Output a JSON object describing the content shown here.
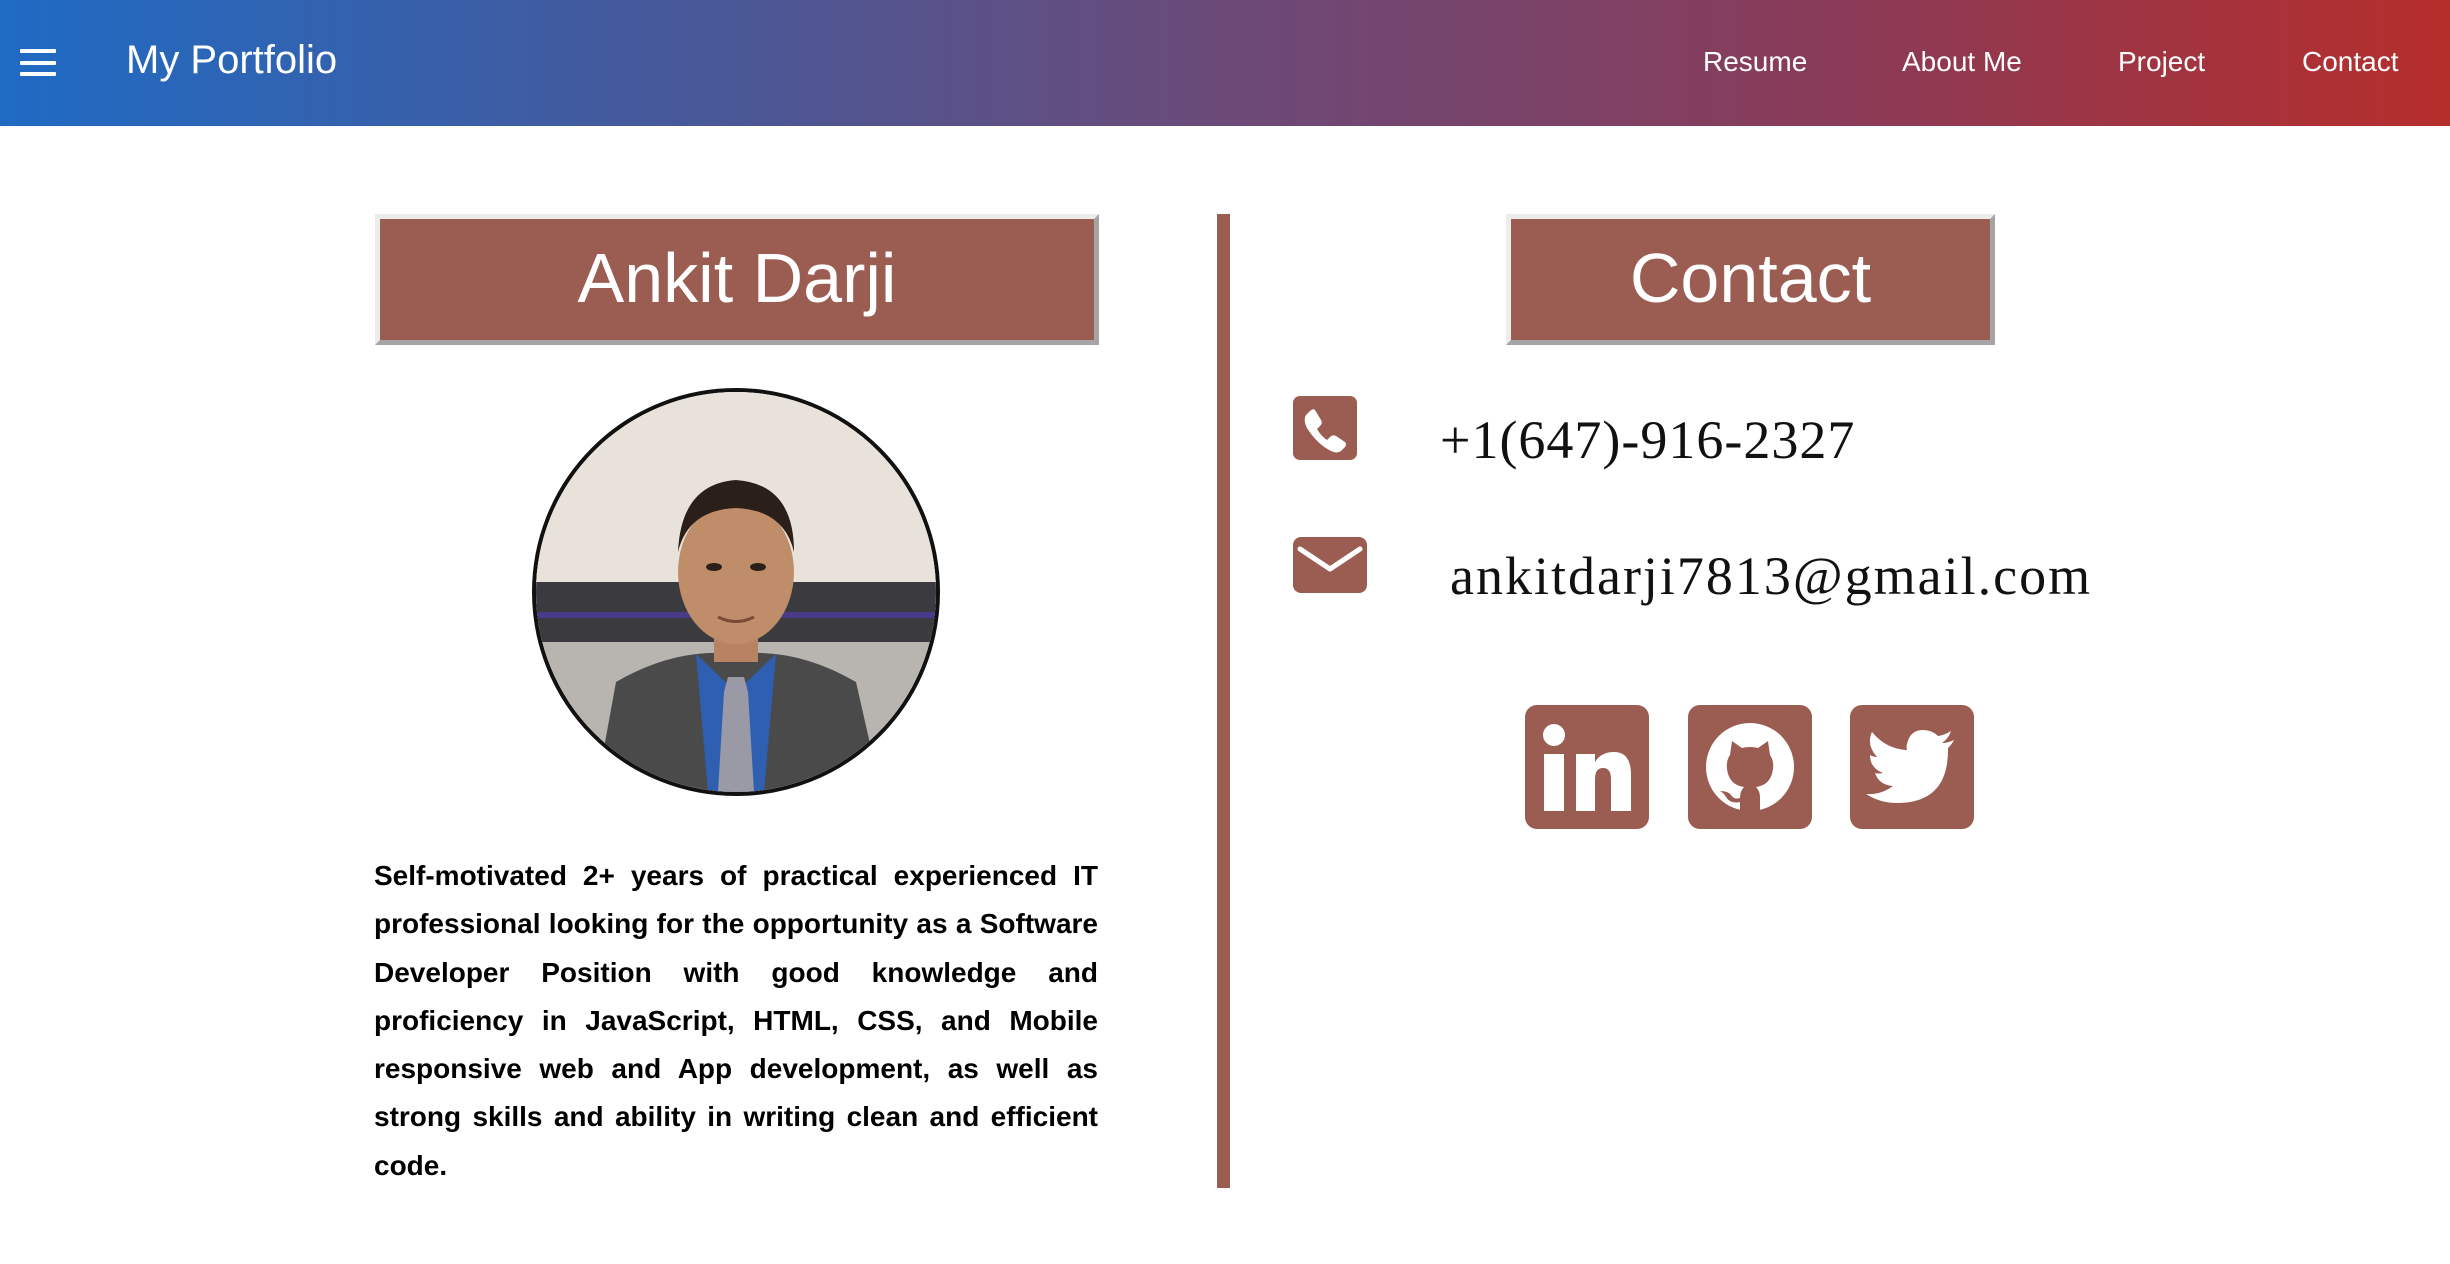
{
  "header": {
    "brand": "My Portfolio",
    "nav": [
      "Resume",
      "About Me",
      "Project",
      "Contact"
    ],
    "menu_icon": "hamburger-menu-icon"
  },
  "profile": {
    "name": "Ankit Darji",
    "bio": "Self-motivated 2+ years of practical experienced IT professional looking for the opportunity as a Software Developer Position with good knowledge and proficiency in JavaScript, HTML, CSS, and Mobile responsive web and App development, as well as strong skills and ability in writing clean and efficient code."
  },
  "contact": {
    "title": "Contact",
    "phone": "+1(647)-916-2327",
    "email": "ankitdarji7813@gmail.com",
    "phone_icon": "phone-icon",
    "email_icon": "envelope-icon"
  },
  "social": [
    "linkedin-icon",
    "github-icon",
    "twitter-icon"
  ],
  "colors": {
    "accent": "#9b5c52",
    "header_gradient_start": "#1f6bc4",
    "header_gradient_end": "#b62e2c"
  }
}
